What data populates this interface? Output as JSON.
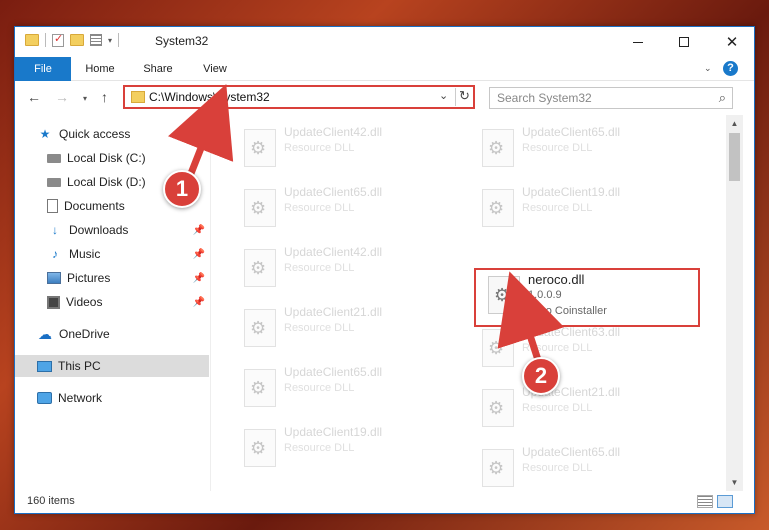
{
  "window": {
    "title": "System32"
  },
  "ribbon": {
    "tabs": [
      "File",
      "Home",
      "Share",
      "View"
    ],
    "help": "?"
  },
  "nav": {
    "path": "C:\\Windows\\System32",
    "search_placeholder": "Search System32"
  },
  "sidebar": {
    "items": [
      {
        "label": "Quick access",
        "icon": "star-icon",
        "pinned": false
      },
      {
        "label": "Local Disk (C:)",
        "icon": "disk-icon",
        "pinned": false
      },
      {
        "label": "Local Disk (D:)",
        "icon": "disk-icon",
        "pinned": false
      },
      {
        "label": "Documents",
        "icon": "documents-icon",
        "pinned": false
      },
      {
        "label": "Downloads",
        "icon": "download-icon",
        "pinned": true
      },
      {
        "label": "Music",
        "icon": "music-icon",
        "pinned": true
      },
      {
        "label": "Pictures",
        "icon": "pictures-icon",
        "pinned": true
      },
      {
        "label": "Videos",
        "icon": "videos-icon",
        "pinned": true
      },
      {
        "label": "OneDrive",
        "icon": "cloud-icon",
        "pinned": false
      },
      {
        "label": "This PC",
        "icon": "computer-icon",
        "pinned": false,
        "selected": true
      },
      {
        "label": "Network",
        "icon": "network-icon",
        "pinned": false
      }
    ]
  },
  "files": [
    {
      "name": "UpdateClient42.dll",
      "type": "Resource DLL"
    },
    {
      "name": "UpdateClient65.dll",
      "type": "Resource DLL"
    },
    {
      "name": "UpdateClient65.dll",
      "type": "Resource DLL"
    },
    {
      "name": "UpdateClient19.dll",
      "type": "Resource DLL"
    },
    {
      "name": "UpdateClient42.dll",
      "type": "Resource DLL"
    },
    {
      "name": "neroco.dll",
      "type": "1.0.0.9",
      "description": "Nero Coinstaller",
      "highlighted": true
    },
    {
      "name": "UpdateClient21.dll",
      "type": "Resource DLL"
    },
    {
      "name": "UpdateClient63.dll",
      "type": "Resource DLL"
    },
    {
      "name": "UpdateClient65.dll",
      "type": "Resource DLL"
    },
    {
      "name": "UpdateClient21.dll",
      "type": "Resource DLL"
    },
    {
      "name": "UpdateClient19.dll",
      "type": "Resource DLL"
    },
    {
      "name": "UpdateClient65.dll",
      "type": "Resource DLL"
    }
  ],
  "status": {
    "item_count": "160 items"
  },
  "annotations": {
    "step1": "1",
    "step2": "2",
    "color": "#d9403a"
  }
}
